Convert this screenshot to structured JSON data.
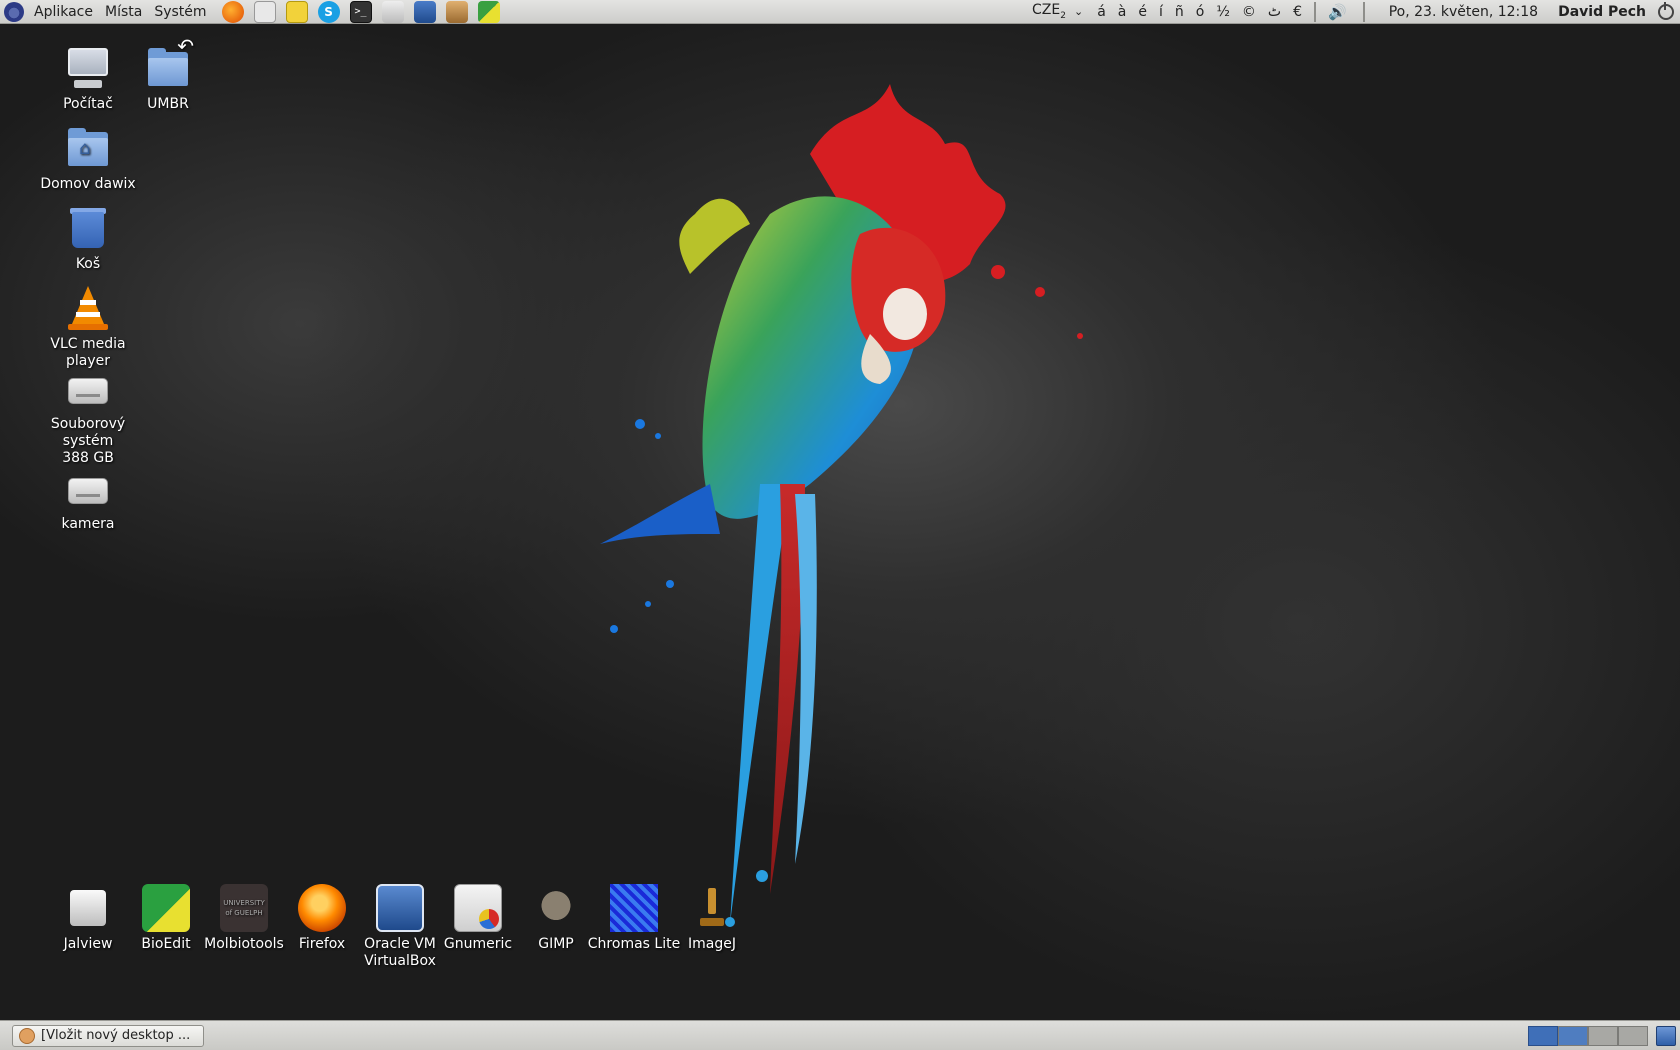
{
  "top_panel": {
    "menus": [
      "Aplikace",
      "Místa",
      "Systém"
    ],
    "launchers": [
      {
        "name": "firefox-launcher-icon",
        "color": "#e66000"
      },
      {
        "name": "network-launcher-icon",
        "color": "#9a9a9a"
      },
      {
        "name": "notes-launcher-icon",
        "color": "#e8c220"
      },
      {
        "name": "skype-launcher-icon",
        "color": "#1a9fe0"
      },
      {
        "name": "terminal-launcher-icon",
        "color": "#333333"
      },
      {
        "name": "jalview-launcher-icon",
        "color": "#c7c7c7"
      },
      {
        "name": "virtualbox-launcher-icon",
        "color": "#2f5aa0"
      },
      {
        "name": "archive-launcher-icon",
        "color": "#b88a50"
      },
      {
        "name": "bioedit-launcher-icon",
        "color": "#3aa040"
      }
    ],
    "keyboard_layout": "CZE",
    "keyboard_sub": "2",
    "special_chars": [
      "á",
      "à",
      "é",
      "í",
      "ñ",
      "ó",
      "½",
      "©",
      "ٹ",
      "€"
    ],
    "clock": "Po, 23. květen, 12:18",
    "user": "David Pech"
  },
  "desktop": {
    "icons_left": [
      {
        "label": "Počítač",
        "type": "computer"
      },
      {
        "label": "UMBR",
        "type": "folder-link"
      },
      {
        "label": "Domov dawix",
        "type": "home"
      },
      {
        "label": "Koš",
        "type": "trash"
      },
      {
        "label": "VLC media player",
        "type": "vlc"
      },
      {
        "label": "Souborový systém",
        "label2": "388 GB",
        "type": "drive"
      },
      {
        "label": "kamera",
        "type": "drive"
      }
    ],
    "apps_bottom": [
      {
        "label": "Jalview",
        "label2": ""
      },
      {
        "label": "BioEdit",
        "label2": ""
      },
      {
        "label": "Molbiotools",
        "label2": ""
      },
      {
        "label": "Firefox",
        "label2": ""
      },
      {
        "label": "Oracle VM",
        "label2": "VirtualBox"
      },
      {
        "label": "Gnumeric",
        "label2": ""
      },
      {
        "label": "GIMP",
        "label2": ""
      },
      {
        "label": "Chromas Lite",
        "label2": ""
      },
      {
        "label": "ImageJ",
        "label2": ""
      }
    ],
    "molbio_logo_text": "UNIVERSITY of GUELPH"
  },
  "bottom_panel": {
    "task_label": "[Vložit nový desktop ..."
  },
  "colors": {
    "ws_active": "#3f6fb8"
  }
}
